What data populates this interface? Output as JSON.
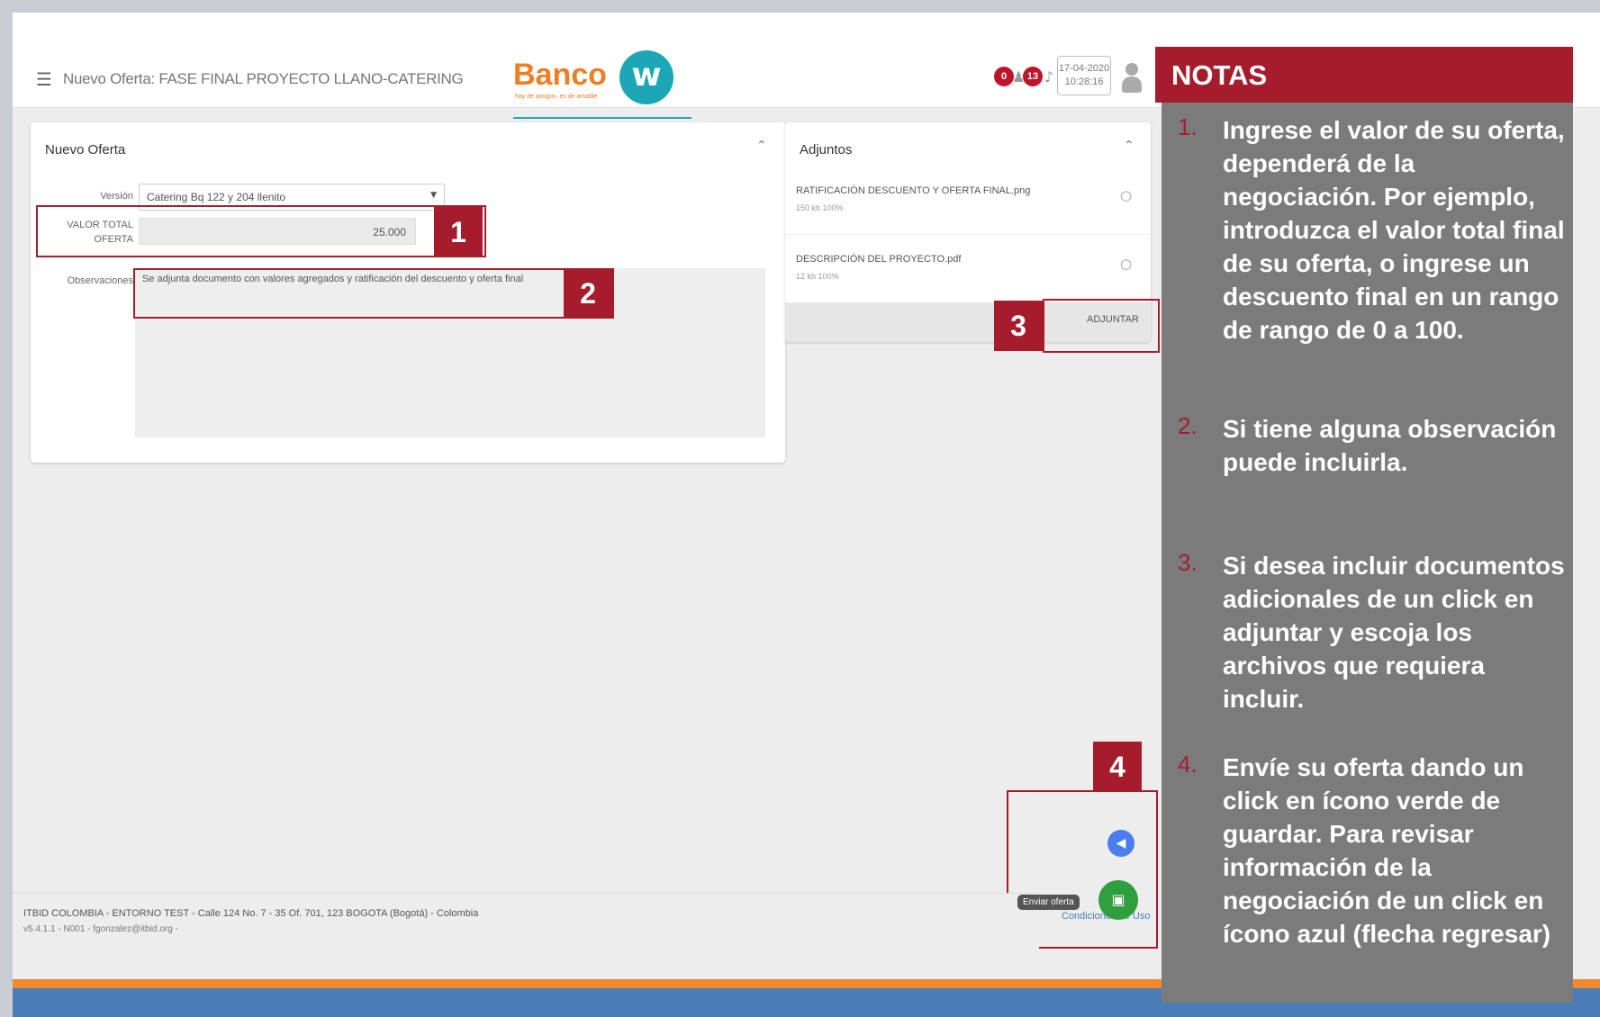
{
  "header": {
    "title": "Nuevo Oferta: FASE FINAL PROYECTO LLANO-CATERING",
    "logo_text": "Banco",
    "logo_mark": "w",
    "logo_tagline": "hay de amigos, es de amable",
    "badge_1": "0",
    "badge_2": "13",
    "date": "17-04-2020",
    "time": "10:28:16"
  },
  "oferta": {
    "title": "Nuevo Oferta",
    "version_label": "Versión",
    "version_value": "Catering Bq 122 y 204 llenito",
    "valor_label_1": "VALOR TOTAL",
    "valor_label_2": "OFERTA",
    "valor_value": "25.000",
    "obs_label": "Observaciones",
    "obs_value": "Se adjunta documento con valores agregados y ratificación del descuento y oferta final"
  },
  "adjuntos": {
    "title": "Adjuntos",
    "items": [
      {
        "name": "RATIFICACIÓN DESCUENTO Y OFERTA FINAL.png",
        "meta": "150 kb 100%"
      },
      {
        "name": "DESCRIPCIÓN DEL PROYECTO.pdf",
        "meta": "12 kb 100%"
      }
    ],
    "button": "ADJUNTAR"
  },
  "callouts": [
    "1",
    "2",
    "3",
    "4"
  ],
  "footer": {
    "line1": "ITBID COLOMBIA - ENTORNO TEST - Calle 124 No. 7 - 35 Of. 701, 123 BOGOTA (Bogotá) - Colombia",
    "line2": "v5.4.1.1 - N001 - fgonzalez@itbid.org -",
    "right": "Condiciones de Uso"
  },
  "actions": {
    "tooltip": "Enviar oferta"
  },
  "notes": {
    "title": "NOTAS",
    "items": [
      {
        "num": "1.",
        "text": "Ingrese el valor de  su oferta, dependerá de la negociación. Por ejemplo, introduzca el valor total final de su oferta, o ingrese un descuento final en un rango de rango de 0 a 100."
      },
      {
        "num": "2.",
        "text": "Si tiene alguna observación puede incluirla."
      },
      {
        "num": "3.",
        "text": "Si desea incluir documentos adicionales de un click en adjuntar y escoja los archivos que requiera incluir."
      },
      {
        "num": "4.",
        "text": "Envíe su oferta dando un click en ícono verde de guardar.  Para revisar información de la negociación de un click en ícono azul (flecha regresar)"
      }
    ]
  },
  "colors": {
    "accent_red": "#a51d2d",
    "brand_orange": "#ef7d22",
    "brand_teal": "#1da6b6",
    "save_green": "#2e9e3e",
    "back_blue": "#4a7df0"
  }
}
